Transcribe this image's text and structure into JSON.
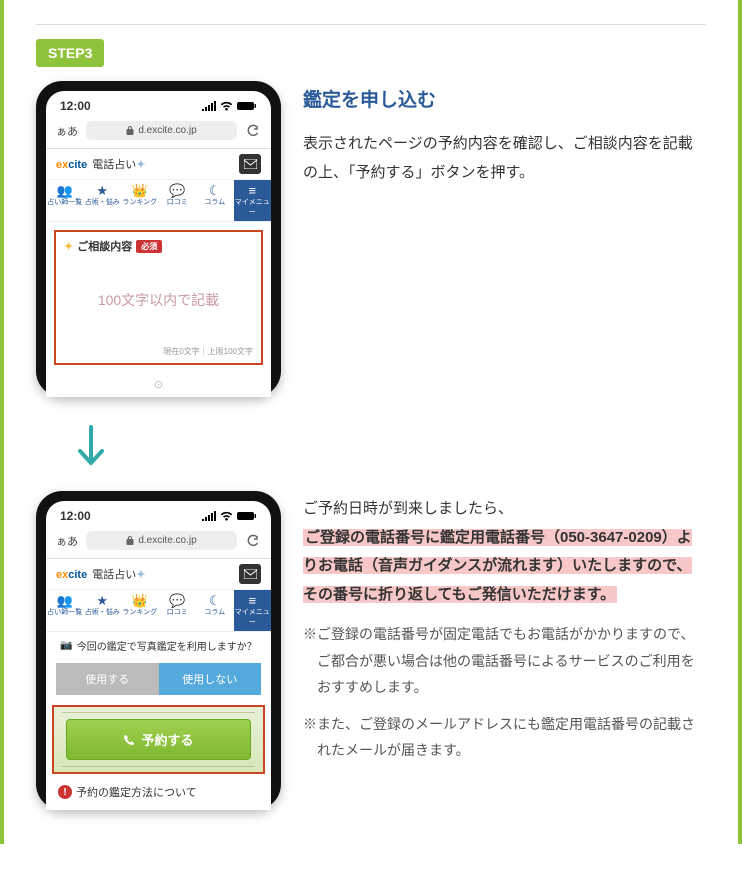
{
  "step": {
    "badge": "STEP3"
  },
  "heading": "鑑定を申し込む",
  "desc1": "表示されたページの予約内容を確認し、ご相談内容を記載の上、「予約する」ボタンを押す。",
  "desc2": {
    "plain": "ご予約日時が到来しましたら、",
    "hl": "ご登録の電話番号に鑑定用電話番号（050-3647-0209）よりお電話（音声ガイダンスが流れます）いたしますので、 その番号に折り返してもご発信いただけます。"
  },
  "note1": "※ご登録の電話番号が固定電話でもお電話がかかりますので、 ご都合が悪い場合は他の電話番号によるサービスのご利用をおすすめします。",
  "note2": "※また、ご登録のメールアドレスにも鑑定用電話番号の記載されたメールが届きます。",
  "phone": {
    "time": "12:00",
    "urlbar": {
      "aa": "ぁあ",
      "url": "d.excite.co.jp"
    },
    "brand": {
      "ex": "ex",
      "cite": "cite",
      "rest": " 電話占い"
    },
    "tabs": [
      "占い師一覧",
      "占術・悩み",
      "ランキング",
      "口コミ",
      "コラム",
      "マイメニュー"
    ],
    "consult": {
      "title": "ご相談内容",
      "req": "必須",
      "placeholder": "100文字以内で記載",
      "counter": "現在0文字｜上限100文字"
    },
    "camera_q": "今回の鑑定で写真鑑定を利用しますか？",
    "use": "使用する",
    "nouse": "使用しない",
    "reserve": "予約する",
    "about": "予約の鑑定方法について"
  }
}
